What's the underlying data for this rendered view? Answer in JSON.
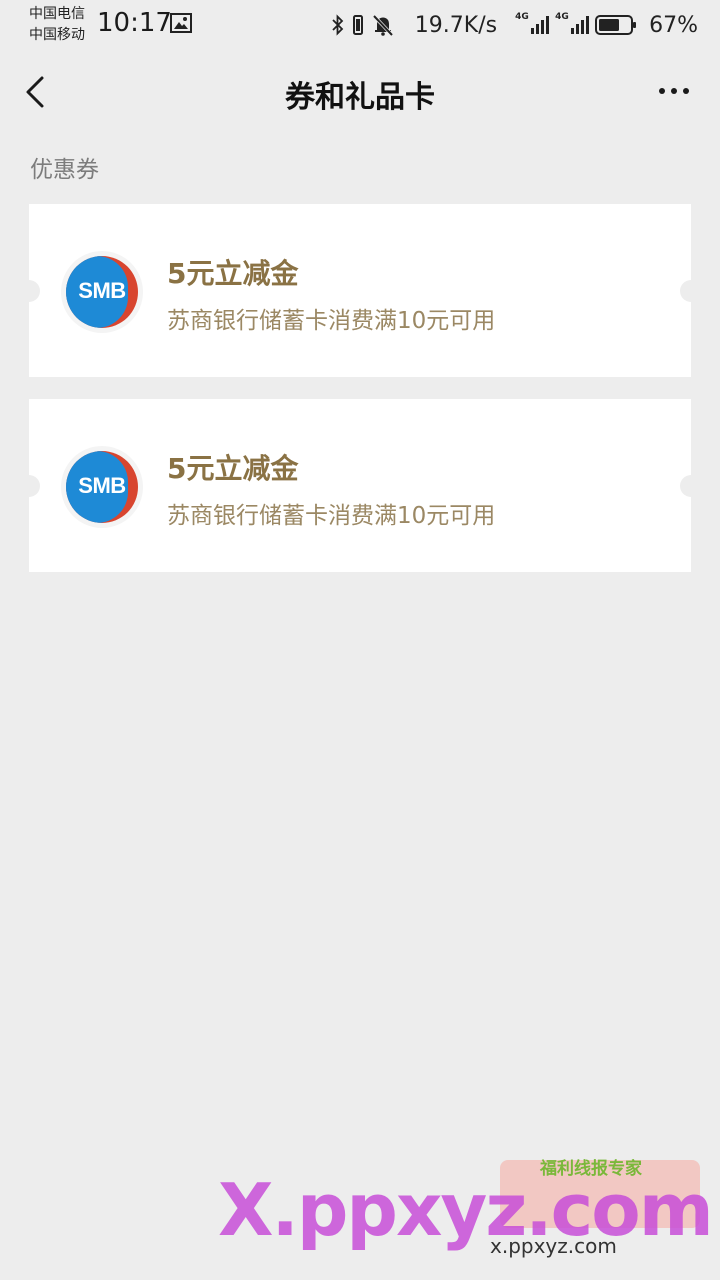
{
  "status_bar": {
    "carrier_1": "中国电信",
    "carrier_2": "中国移动",
    "time": "10:17",
    "net_speed": "19.7K/s",
    "signal_1_label": "4G",
    "signal_2_label": "4G",
    "battery_percent": "67%",
    "battery_level": 0.67,
    "icons": [
      "gallery-icon",
      "bluetooth-icon",
      "vibrate-icon",
      "mute-bell-icon",
      "signal-icon",
      "battery-icon"
    ]
  },
  "nav": {
    "title": "券和礼品卡",
    "back_icon": "chevron-left-icon",
    "more_icon": "more-dots-icon"
  },
  "section": {
    "label": "优惠券"
  },
  "coupons": [
    {
      "logo_text": "SMB",
      "title": "5元立减金",
      "description": "苏商银行储蓄卡消费满10元可用"
    },
    {
      "logo_text": "SMB",
      "title": "5元立减金",
      "description": "苏商银行储蓄卡消费满10元可用"
    }
  ],
  "watermark": {
    "text": "X.ppxyz.com",
    "badge_text": "福利线报专家",
    "url": "x.ppxyz.com"
  },
  "colors": {
    "background": "#ededed",
    "card": "#ffffff",
    "coupon_title": "#8a7244",
    "coupon_desc": "#9b8864",
    "smb_blue": "#1e8ad6",
    "smb_red": "#d8452f"
  }
}
